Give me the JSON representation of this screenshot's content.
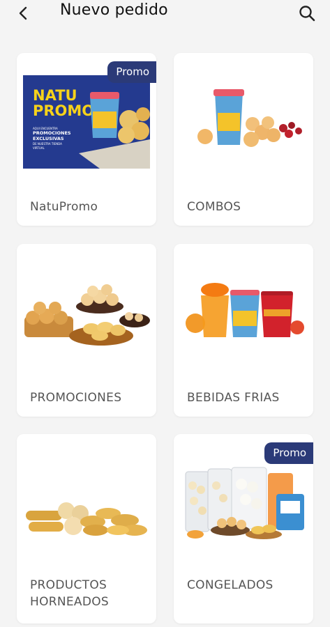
{
  "header": {
    "title": "Nuevo pedido",
    "back_icon": "chevron-left-icon",
    "search_icon": "search-icon"
  },
  "categories": [
    {
      "label": "NatuPromo",
      "promo": "Promo",
      "banner": {
        "line1": "NATU",
        "line2": "PROMO",
        "text1": "AQUI ENCUENTRA",
        "text2": "PROMOCIONES",
        "text3": "EXCLUSIVAS",
        "text4": "DE NUESTRA TIENDA",
        "text5": "VIRTUAL"
      }
    },
    {
      "label": "COMBOS"
    },
    {
      "label": "PROMOCIONES"
    },
    {
      "label": "BEBIDAS FRIAS"
    },
    {
      "label_line1": "PRODUCTOS",
      "label_line2": "HORNEADOS"
    },
    {
      "label": "CONGELADOS",
      "promo": "Promo"
    }
  ],
  "colors": {
    "brand_blue": "#2b3a78",
    "banner_blue": "#243a8f",
    "banner_yellow": "#f6d21a"
  }
}
